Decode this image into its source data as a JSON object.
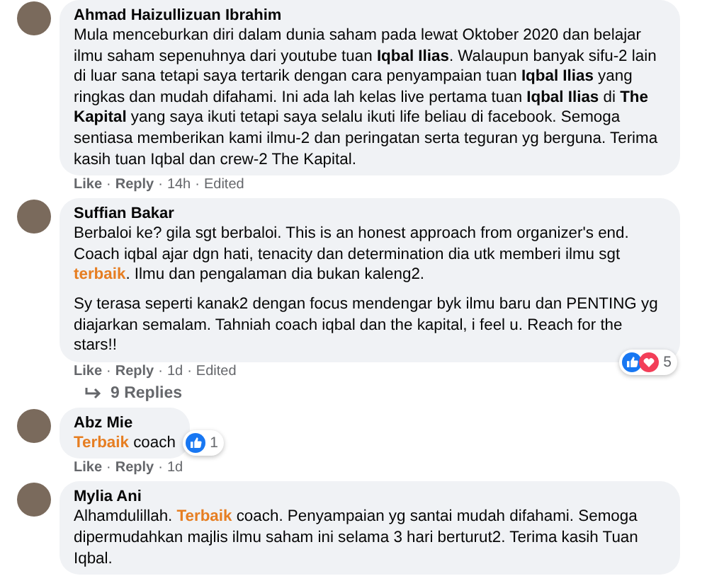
{
  "separator": "·",
  "comments": [
    {
      "author": "Ahmad Haizullizuan Ibrahim",
      "paragraphs": [
        [
          {
            "kind": "plain",
            "text": "Mula menceburkan diri dalam dunia saham pada lewat Oktober 2020 dan belajar ilmu saham sepenuhnya dari youtube tuan "
          },
          {
            "kind": "bold",
            "text": "Iqbal Ilias"
          },
          {
            "kind": "plain",
            "text": ". Walaupun banyak sifu-2 lain di luar sana tetapi saya tertarik dengan cara penyampaian tuan "
          },
          {
            "kind": "bold",
            "text": "Iqbal Ilias"
          },
          {
            "kind": "plain",
            "text": " yang ringkas dan mudah difahami. Ini ada lah kelas live pertama tuan "
          },
          {
            "kind": "bold",
            "text": "Iqbal Ilias"
          },
          {
            "kind": "plain",
            "text": " di "
          },
          {
            "kind": "bold",
            "text": "The Kapital"
          },
          {
            "kind": "plain",
            "text": " yang saya ikuti tetapi saya selalu ikuti life beliau di facebook. Semoga sentiasa memberikan kami ilmu-2 dan peringatan serta teguran yg berguna. Terima kasih tuan Iqbal dan crew-2 The Kapital."
          }
        ]
      ],
      "actions": [
        "Like",
        "Reply",
        "14h",
        "Edited"
      ]
    },
    {
      "author": "Suffian Bakar",
      "paragraphs": [
        [
          {
            "kind": "plain",
            "text": "Berbaloi ke? gila sgt berbaloi. This is an honest approach from organizer's end. Coach iqbal ajar dgn hati, tenacity dan determination dia utk memberi ilmu sgt "
          },
          {
            "kind": "highlight",
            "text": "terbaik"
          },
          {
            "kind": "plain",
            "text": ". Ilmu dan pengalaman dia bukan kaleng2."
          }
        ],
        [
          {
            "kind": "plain",
            "text": "Sy terasa seperti kanak2 dengan focus mendengar byk ilmu baru dan PENTING yg diajarkan semalam. Tahniah coach iqbal dan the kapital, i feel u. Reach for the stars!!"
          }
        ]
      ],
      "reactions": {
        "love": true,
        "count": "5"
      },
      "actions": [
        "Like",
        "Reply",
        "1d",
        "Edited"
      ],
      "replies": "9 Replies"
    },
    {
      "author": "Abz Mie",
      "paragraphs": [
        [
          {
            "kind": "highlight",
            "text": "Terbaik"
          },
          {
            "kind": "plain",
            "text": " coach"
          }
        ]
      ],
      "reactions": {
        "love": false,
        "count": "1"
      },
      "actions": [
        "Like",
        "Reply",
        "1d"
      ]
    },
    {
      "author": "Mylia Ani",
      "paragraphs": [
        [
          {
            "kind": "plain",
            "text": "Alhamdulillah. "
          },
          {
            "kind": "highlight",
            "text": "Terbaik"
          },
          {
            "kind": "plain",
            "text": " coach. Penyampaian yg santai mudah difahami. Semoga dipermudahkan majlis ilmu saham ini selama 3 hari berturut2. Terima kasih Tuan Iqbal."
          }
        ]
      ]
    }
  ]
}
